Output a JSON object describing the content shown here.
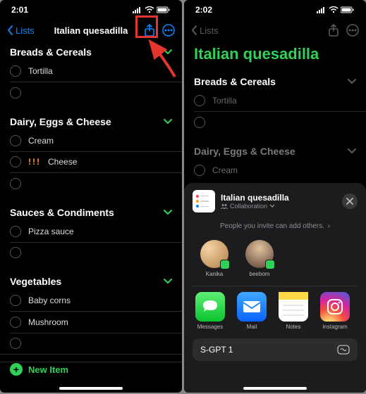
{
  "left": {
    "statusbar_time": "2:01",
    "back_label": "Lists",
    "title": "Italian quesadilla",
    "sections": [
      {
        "name": "Breads & Cereals",
        "items": [
          "Tortilla",
          ""
        ]
      },
      {
        "name": "Dairy, Eggs & Cheese",
        "items": [
          "Cream",
          {
            "priority": "!!!",
            "text": "Cheese"
          },
          ""
        ]
      },
      {
        "name": "Sauces & Condiments",
        "items": [
          "Pizza sauce",
          ""
        ]
      },
      {
        "name": "Vegetables",
        "items": [
          "Baby corns",
          "Mushroom",
          ""
        ]
      }
    ],
    "add_label": "New Item"
  },
  "right": {
    "statusbar_time": "2:02",
    "back_label": "Lists",
    "title": "Italian quesadilla",
    "sections": [
      {
        "name": "Breads & Cereals",
        "items": [
          "Tortilla",
          ""
        ]
      },
      {
        "name": "Dairy, Eggs & Cheese",
        "items": [
          "Cream"
        ]
      }
    ],
    "share": {
      "sheet_title": "Italian quesadilla",
      "mode": "Collaboration",
      "info": "People you invite can add others.",
      "contacts": [
        "Kanika",
        "beebom"
      ],
      "apps": [
        "Messages",
        "Mail",
        "Notes",
        "Instagram"
      ],
      "action1": "S-GPT 1"
    }
  },
  "colors": {
    "accent_green": "#30d158",
    "ios_blue": "#0a84ff",
    "annotation_red": "#e5352f"
  }
}
